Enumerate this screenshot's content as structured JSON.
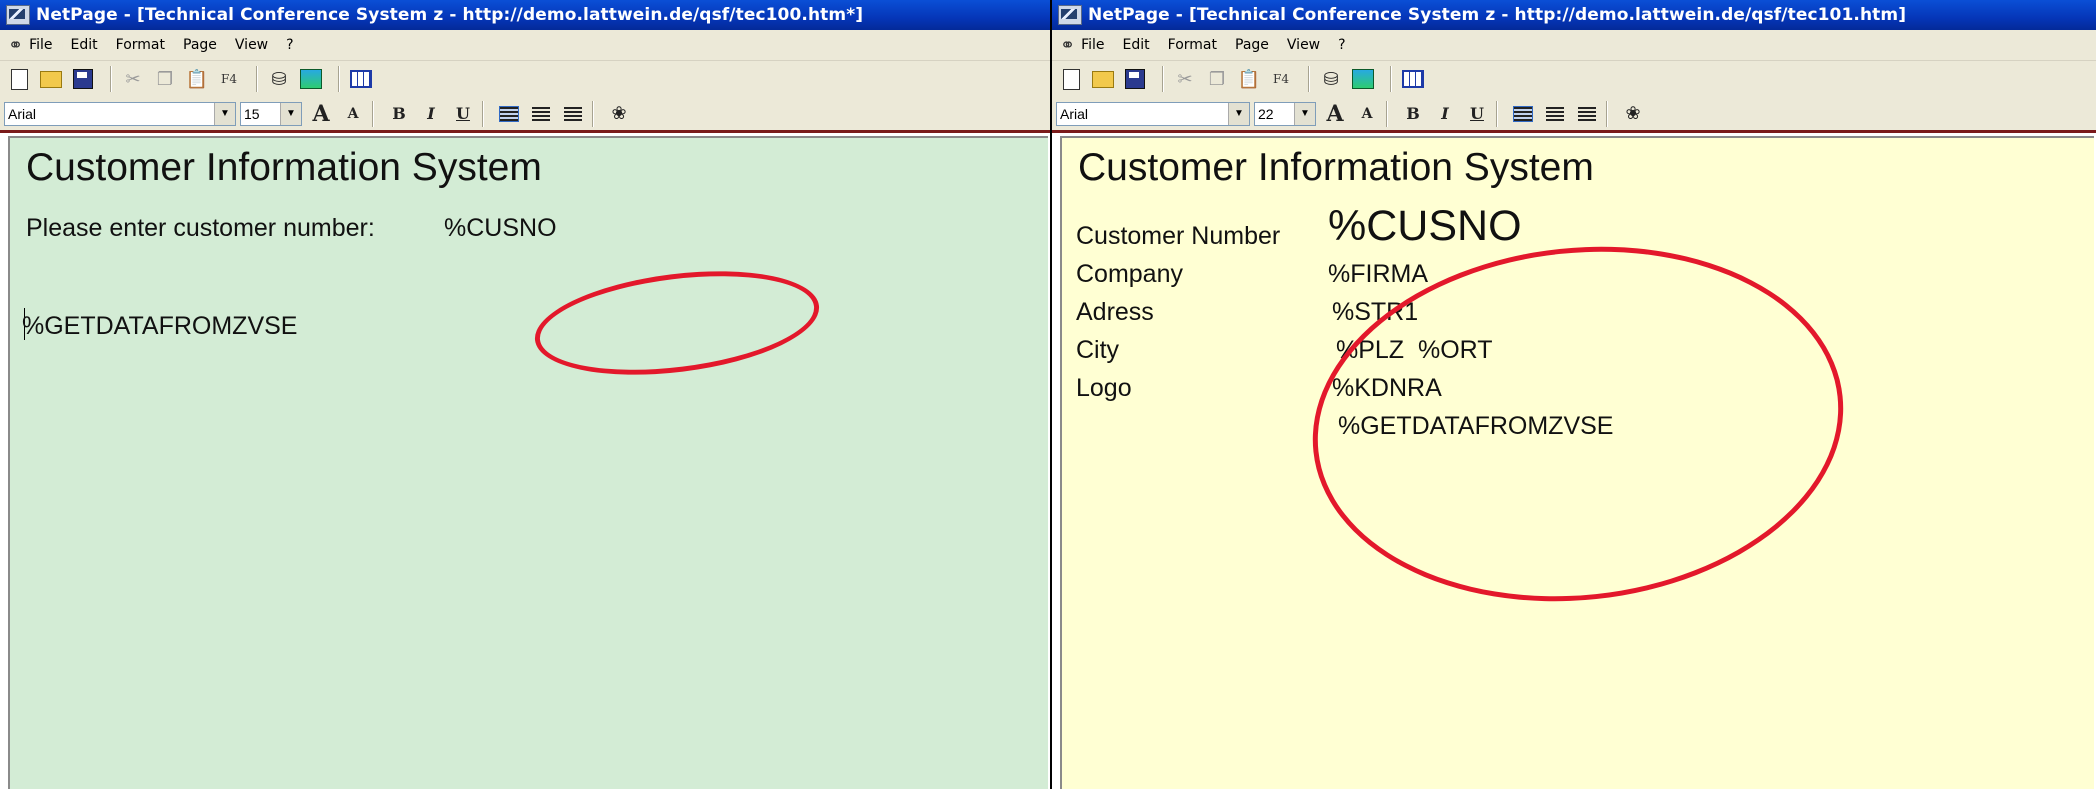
{
  "windows": [
    {
      "title": "NetPage - [Technical Conference System z - http://demo.lattwein.de/qsf/tec100.htm*]",
      "menu": [
        "File",
        "Edit",
        "Format",
        "Page",
        "View",
        "?"
      ],
      "toolbar": {
        "f4_label": "F4"
      },
      "format": {
        "font": "Arial",
        "size": "15",
        "bold": "B",
        "italic": "I",
        "underline": "U"
      },
      "doc": {
        "background": "#d3ecd5",
        "heading": "Customer Information System",
        "prompt": "Please enter customer number:",
        "cusno": "%CUSNO",
        "getdata": "%GETDATAFROMZVSE"
      }
    },
    {
      "title": "NetPage - [Technical Conference System z - http://demo.lattwein.de/qsf/tec101.htm]",
      "menu": [
        "File",
        "Edit",
        "Format",
        "Page",
        "View",
        "?"
      ],
      "toolbar": {
        "f4_label": "F4"
      },
      "format": {
        "font": "Arial",
        "size": "22",
        "bold": "B",
        "italic": "I",
        "underline": "U"
      },
      "doc": {
        "background": "#ffffd3",
        "heading": "Customer Information System",
        "fields": [
          {
            "label": "Customer Number",
            "value": "%CUSNO"
          },
          {
            "label": "Company",
            "value": "%FIRMA"
          },
          {
            "label": "Adress",
            "value": "%STR1"
          },
          {
            "label": "City",
            "value": "%PLZ  %ORT"
          },
          {
            "label": "Logo",
            "value": "%KDNRA"
          }
        ],
        "getdata": "%GETDATAFROMZVSE"
      }
    }
  ],
  "annotation_color": "#e3182b"
}
